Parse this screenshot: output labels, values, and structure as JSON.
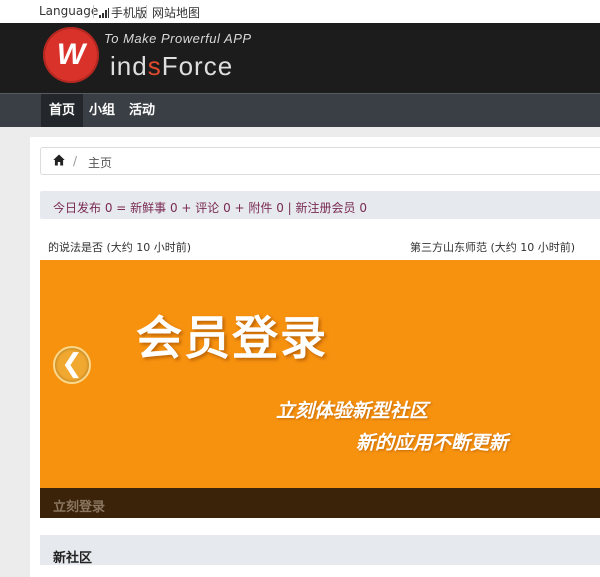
{
  "topbar": {
    "language": "Language",
    "mobile": "手机版",
    "sitemap": "网站地图"
  },
  "header": {
    "logo_letter": "W",
    "slogan": "To Make Prowerful APP",
    "brand_prefix": "ind",
    "brand_accent": "s",
    "brand_suffix": "Force",
    "accent_color": "#e04a2f"
  },
  "nav": {
    "items": [
      {
        "label": "首页",
        "active": true
      },
      {
        "label": "小组",
        "active": false
      },
      {
        "label": "活动",
        "active": false
      }
    ]
  },
  "breadcrumb": {
    "home_icon": "home-icon",
    "current": "主页"
  },
  "stats": {
    "text": "今日发布 0 = 新鲜事 0 + 评论 0 + 附件 0 | 新注册会员 0"
  },
  "ticker": {
    "left": "的说法是否 (大约 10 小时前)",
    "right": "第三方山东师范 (大约 10 小时前)"
  },
  "banner": {
    "headline": "会员登录",
    "sub1": "立刻体验新型社区",
    "sub2": "新的应用不断更新",
    "prev_icon": "❮",
    "caption": "立刻登录",
    "bg_color": "#f7920f"
  },
  "section": {
    "title": "新社区"
  }
}
